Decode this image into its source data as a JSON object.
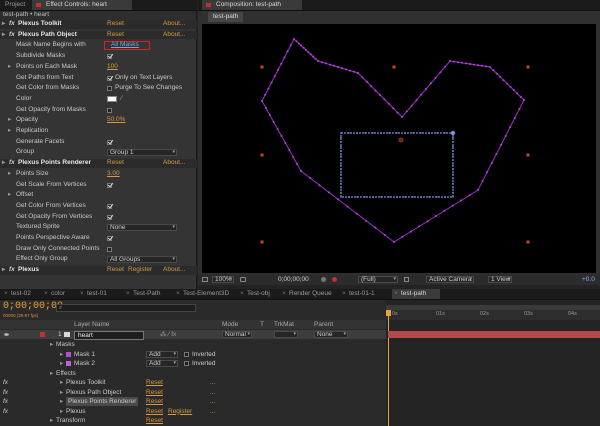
{
  "left_panel": {
    "tabs": [
      {
        "label": "Project"
      },
      {
        "label": "Effect Controls: heart"
      }
    ],
    "subhead": "test-path • heart",
    "effects": [
      {
        "type": "effect",
        "label": "Plexus Toolkit",
        "reset": "Reset",
        "about": "About..."
      },
      {
        "type": "effect",
        "label": "Plexus Path Object",
        "reset": "Reset",
        "about": "About..."
      },
      {
        "type": "dropdown",
        "label": "Mask Name Begins with",
        "value": "All Masks"
      },
      {
        "type": "check",
        "label": "Subdivide Masks",
        "checked": true
      },
      {
        "type": "value",
        "label": "Points on Each Mask",
        "value": "100"
      },
      {
        "type": "check",
        "label": "Get Paths from Text",
        "checked": true,
        "extra": "Only on Text Layers"
      },
      {
        "type": "check",
        "label": "Get Color from Masks",
        "checked": false,
        "extra": "Purge To See Changes"
      },
      {
        "type": "color",
        "label": "Color"
      },
      {
        "type": "check",
        "label": "Get Opacity from Masks",
        "checked": false
      },
      {
        "type": "value",
        "label": "Opacity",
        "value": "50.0%"
      },
      {
        "type": "group",
        "label": "Replication"
      },
      {
        "type": "check",
        "label": "Generate Facets",
        "checked": true
      },
      {
        "type": "dropdown",
        "label": "Group",
        "value": "Group 1"
      },
      {
        "type": "effect",
        "label": "Plexus Points Renderer",
        "reset": "Reset",
        "about": "About..."
      },
      {
        "type": "value",
        "label": "Points Size",
        "value": "3.00"
      },
      {
        "type": "check",
        "label": "Get Scale From Vertices",
        "checked": true
      },
      {
        "type": "group",
        "label": "Offset"
      },
      {
        "type": "check",
        "label": "Get Color From Vertices",
        "checked": true
      },
      {
        "type": "check",
        "label": "Get Opacity From Vertices",
        "checked": true
      },
      {
        "type": "dropdown",
        "label": "Textured Sprite",
        "value": "None"
      },
      {
        "type": "check",
        "label": "Points Perspective Aware",
        "checked": true
      },
      {
        "type": "check",
        "label": "Draw Only Connected Points",
        "checked": false
      },
      {
        "type": "dropdown",
        "label": "Effect Only Group",
        "value": "All Groups"
      },
      {
        "type": "effect2",
        "label": "Plexus",
        "reset": "Reset",
        "register": "Register",
        "about": "About..."
      }
    ]
  },
  "comp_panel": {
    "tab": "Composition: test-path",
    "subtab": "test-path",
    "footer": {
      "zoom": "100%",
      "timecode": "0;00;00;00",
      "resolution": "(Full)",
      "camera": "Active Camera",
      "view": "1 View",
      "exposure": "+0.0"
    }
  },
  "timeline": {
    "tabs": [
      "test-02",
      "color",
      "test-01",
      "Test-Path",
      "Test-Element3D",
      "Test-obj",
      "Render Queue",
      "test-01-1",
      "test-path"
    ],
    "timecode": "0;00;00;00",
    "fps": "00000 (29.97 fps)",
    "search_placeholder": "",
    "columns": {
      "layer_name": "Layer Name",
      "mode": "Mode",
      "t": "T",
      "trkmat": "TrkMat",
      "parent": "Parent"
    },
    "ruler": [
      "0s",
      "01s",
      "02s",
      "03s",
      "04s"
    ],
    "layer": {
      "num": "1",
      "name": "heart",
      "mode": "Normal",
      "parent": "None"
    },
    "rows": [
      {
        "indent": 1,
        "label": "Masks"
      },
      {
        "indent": 2,
        "label": "Mask 1",
        "mode": "Add",
        "inverted": "Inverted",
        "color": "#b050d0"
      },
      {
        "indent": 2,
        "label": "Mask 2",
        "mode": "Add",
        "inverted": "Inverted",
        "color": "#c060e0"
      },
      {
        "indent": 1,
        "label": "Effects"
      },
      {
        "indent": 2,
        "label": "Plexus Toolkit",
        "reset": "Reset",
        "fx": true
      },
      {
        "indent": 2,
        "label": "Plexus Path Object",
        "reset": "Reset",
        "fx": true
      },
      {
        "indent": 2,
        "label": "Plexus Points Renderer",
        "reset": "Reset",
        "fx": true,
        "selected": true
      },
      {
        "indent": 2,
        "label": "Plexus",
        "reset": "Reset",
        "register": "Register",
        "fx": true
      },
      {
        "indent": 1,
        "label": "Transform",
        "reset": "Reset"
      }
    ]
  },
  "colors": {
    "accent": "#e8a33a",
    "point": "#c040e8",
    "selection": "#6a8ad0",
    "marker": "#c04a20"
  }
}
